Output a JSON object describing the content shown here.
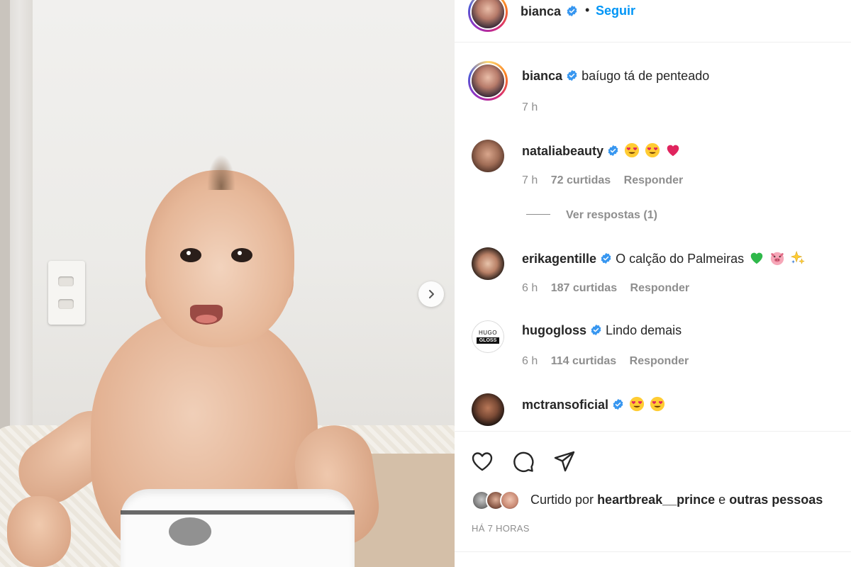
{
  "post": {
    "author": "bianca",
    "follow_label": "Seguir",
    "dot": "•",
    "caption_user": "bianca",
    "caption_text": "baíugo tá de penteado",
    "caption_time": "7 h"
  },
  "comments": [
    {
      "user": "nataliabeauty",
      "text": "",
      "emojis": [
        "heart-eyes",
        "heart-eyes",
        "red-heart"
      ],
      "time": "7 h",
      "likes": "72 curtidas",
      "reply": "Responder"
    },
    {
      "user": "erikagentille",
      "text": "O calção do Palmeiras",
      "emojis": [
        "green-heart",
        "pig-face",
        "sparkles"
      ],
      "time": "6 h",
      "likes": "187 curtidas",
      "reply": "Responder"
    },
    {
      "user": "hugogloss",
      "text": "Lindo demais",
      "emojis": [],
      "time": "6 h",
      "likes": "114 curtidas",
      "reply": "Responder"
    },
    {
      "user": "mctransoficial",
      "text": "",
      "emojis": [
        "heart-eyes",
        "heart-eyes"
      ],
      "time": "",
      "likes": "",
      "reply": ""
    }
  ],
  "view_replies": "Ver respostas (1)",
  "hugo_logo": {
    "top": "HUGO",
    "bottom": "GLOSS"
  },
  "likes_line": {
    "prefix": "Curtido por",
    "user": "heartbreak__prince",
    "conj": "e",
    "others": "outras pessoas"
  },
  "posted_ago": "HÁ 7 HORAS",
  "colors": {
    "accent": "#0095f6",
    "verified": "#3897f0",
    "secondary_text": "#8e8e8e",
    "primary_text": "#262626"
  },
  "icons": [
    "heart-icon",
    "comment-icon",
    "share-icon",
    "next-arrow-icon",
    "verified-badge-icon"
  ]
}
